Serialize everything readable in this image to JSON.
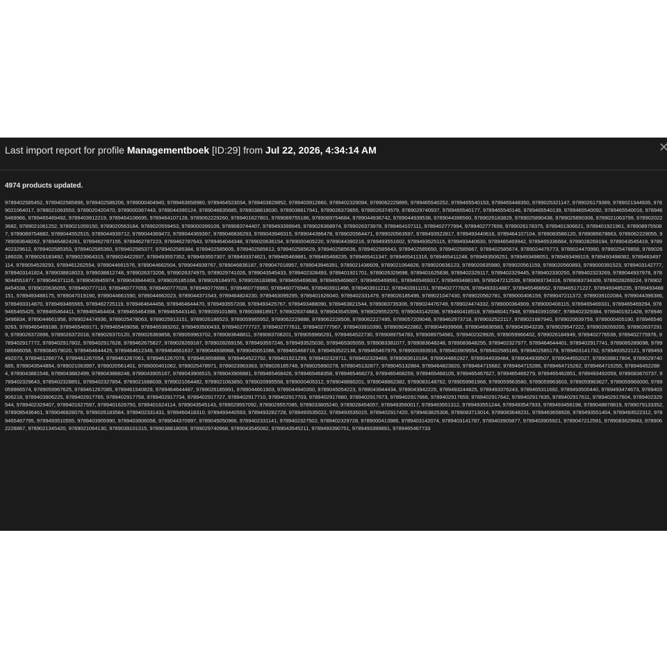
{
  "report": {
    "title_prefix": "Last import report for profile ",
    "profile_name": "Managementboek",
    "profile_id": " [ID:29] from ",
    "timestamp": "Jul 22, 2026, 4:34:14 AM",
    "close_glyph": "✕",
    "summary": "4974 products updated.",
    "codes": "9789402585452, 9789402585896, 9789402586206, 9789000404940, 9789463658980, 9789464523034, 9789403829852, 9789403912660, 9789402329094, 9789062229895, 9789465540252, 9789465540153, 9789465448350, 9789025321147, 9789026179389, 9789021344935, 9789021064017, 9789021063553, 9789020420470, 9789000367443, 9789044390124, 9789046835685, 9789038818030, 9789038817941, 9789026373855, 9789026374579, 9789029740937, 9789465540177, 9789465540146, 9789465540139, 9789465540092, 9789465540016, 9789465469966, 9789465469492, 9789403912219, 9789464106695, 9789464107128, 9789062229260, 9789401627801, 9789089755186, 9789089754684, 9789044936742, 9789044939538, 9789044396560, 9789026183829, 9789025890438, 9789025890308, 9789021063799, 9789020223682, 9789021061252, 9789021059150, 9789020563184, 9789020559453, 9789000399109, 9789083744407, 9789493399945, 9789026368974, 9789026373978, 9789464107111, 9789402777994, 9789402777659, 9789026178375, 9789401306621, 9789401921961, 9789089755087, 9789089754882, 9789044552515, 9789044939712, 9789044369472, 9789044369397, 9789046836293, 9789043946315, 9789044396478, 9789020564471, 9789020563597, 9789493522817, 9789493440616, 9789464107104, 9789083586120, 9789085678663, 9789062229055, 9789083648262, 9789464824261, 9789462787155, 9789462787223, 9789462787643, 9789464044348, 9789020636154, 9789000405220, 9789044390216, 9789493551602, 9789493525115, 9789493440630, 9789465469942, 9789465336664, 9789028269194, 9789043545419, 9789402329612, 9789402585353, 9789402585360, 9789402585377, 9789402585384, 9789402585605, 9789402585612, 9789402585629, 9789402585636, 9789402585643, 9789402585650, 9789402585667, 9789402585674, 9789024475773, 9789024470990, 9789025478858, 9789026186028, 9789026183492, 9789023964315, 9789024422937, 9789493557352, 9789493557307, 9789493374621, 9789465469881, 9789465468235, 9789465411347, 9789465411316, 9789465411248, 9789493506251, 9789493498051, 9789493499119, 9789493498082, 9789463497114, 9789054529293, 9789461262554, 9789044661576, 9789044662504, 9789044939767, 9789046836187, 9789047018957, 9789043946391, 9789021436609, 9789021064826, 9789020636123, 9789020635980, 9789020561159, 9789020560893, 9789000391523, 9789403142777, 9789403141824, 9789038818023, 9789038812748, 9789026373206, 9789026374975, 9789029741026, 9789043545433, 9789402328493, 9789401921701, 9789026329698, 9789401625838, 9789402329117, 9789402329445, 9789402330250, 9789402323269, 9789044937978, 9789044551877, 9789044371116, 9789043945974, 9789043944403, 9789026185168, 9789026184970, 9789026183898, 9789465469638, 9789465469607, 9789465469591, 9789465469317, 9789493488199, 9789047212539, 9789083734316, 9789083734309, 9789028269224, 9789028454538, 9789020636055, 9789460777110, 9789460777059, 9789460777028, 9789460776991, 9789460776960, 9789460776946, 9789403911496, 9789403911212, 9789403911151, 9789402777826, 9789493314887, 9789465468662, 9789465171227, 9789493485235, 9789493488151, 9789493488175, 9789047019190, 9789044661590, 9789044662023, 9789044371543, 9789464824230, 9789463099295, 9789401626040, 9789402331479, 9789026185496, 9789021047430, 9789020562781, 9789000406159, 9789047211372, 9789039102084, 9789044396386, 9789493314870, 9789493465565, 9789462725119, 9789464644456, 9789464644470, 9789493557208, 9789493425767, 9789493488090, 9789463821544, 9789083735306, 9789024476749, 9789024474332, 9789000364909, 9789000408115, 9789465469331, 9789465469294, 9789465465425, 9789465464411, 9789465464404, 9789465464398, 9789465443140, 9789039101889, 9789038818917, 9789026374883, 9789043545396, 9789029552370, 9789043142036, 9789460418518, 9789460417948, 9789403910567, 9789402329384, 9789401921428, 9789463496834, 9789044661958, 9789024474936, 9789025478063, 9789025913151, 9789026186523, 9789059965952, 9789062229888, 9789062228508, 9789062227495, 9789057209048, 9789462973718, 9789032522117, 9789021687940, 9789020639759, 9789000405190, 9789465469263, 9789465469188, 9789465469171, 9789465469058, 9789465383262, 9789493500433, 9789402777727, 9789402777611, 9789402777567, 9789403910390, 9789090422862, 9789044939668, 9789046836583, 9789043943239, 9789029547222, 9789028269200, 9789026372919, 9789026372896, 9789026372018, 9789026370120, 9789026369858, 9789059963702, 9789083648811, 9789083708201, 9789059966291, 9789464522730, 9789089754783, 9789089754981, 9789402329926, 9789059966402, 9789026184949, 9789402776539, 9789402775976, 9789402917772, 9789402917802, 9789402917628, 9789462675827, 9789028269187, 9789028269156, 9789493557246, 9789493525030, 9789465305059, 9789083381077, 9789083648248, 9789083648255, 9789402327977, 9789464644401, 9789402917741, 9789085289098, 9789086666058, 9789084579020, 9789464644425, 9789464612349, 9789464661637, 9789044938968, 9789045051086, 9789465468716, 9789493522138, 9789465467979, 9789000393916, 9789403909554, 9789402585186, 9789402585179, 9789403141732, 9789493522121, 9789493492073, 9789461266774, 9789461267054, 9789461267061, 9789461267078, 9789463658898, 9789464522792, 9789401921299, 9789402329711, 9789402329469, 9789083610184, 9789044661927, 9789044939484, 9789044939507, 9789044552027, 9789038817804, 9789029740685, 9789043544894, 9789021063997, 9789020561401, 9789000401062, 9789025478971, 9789023963363, 9789026185748, 9789025890278, 9789045132877, 9789045132884, 9789464823820, 9789464715682, 9789464715286, 9789464715262, 9789464715255, 9789464522884, 9789043881546, 9789043882499, 9789043888248, 9789043905167, 9789043906515, 9789043906881, 9789465468426, 9789465468358, 9789465468273, 9789465468259, 9789465468105, 9789465467627, 9789465466279, 9789465462851, 9789493492059, 9789083670737, 9789402329643, 9789402328851, 9789402327854, 9789021688039, 9789021064482, 9789021063850, 9789020995558, 9789000405312, 9789048880201, 9789048862382, 9789083148762, 9789059961968, 9789059963580, 9789059963603, 9789059963627, 9789059966000, 9789059966574, 9789059967625, 9789461267085, 9789461540829, 9789464644487, 9789026185991, 9789044661903, 9789044940350, 9789045054223, 9789043944434, 9789043942225, 9789493244825, 9789493376243, 9789465311692, 9789493500440, 9789493474673, 9789403906218, 9789403906225, 9789402917765, 9789402917758, 9789402917734, 9789402917727, 9789402917710, 9789402917703, 9789402917680, 9789402917673, 9789402917666, 9789402917659, 9789402917642, 9789402917635, 9789402917611, 9789402917604, 9789402329544, 9789402329407, 9789401627597, 9789401626750, 9789401624114, 9789043545143, 9789029557092, 9789029557085, 9789033805240, 9789028454057, 9789493560017, 9789493551312, 9789493551244, 9789493547933, 9789493456198, 9789048878819, 9789079133352, 9789085436461, 9789046828076, 9789026183584, 9789402331431, 9789460418310, 9789493440593, 9789493282728, 9789493535022, 9789493535015, 9789402917420, 9789463825306, 9789083713014, 9789083648231, 9789463658928, 9789493551404, 9789493522312, 9789465467795, 9789493510555, 9789403905990, 9789403906058, 9789044370997, 9789045050966, 9789402331141, 9789402327502, 9789402329728, 9789000413986, 9789403142074, 9789403141787, 9789403905877, 9789403905921, 9789047212591, 9789083629643, 9789062228867, 9789021345420, 9789021064130, 9789039101315, 9789038818009, 9789029740968, 9789043545082, 9789043545211, 9789493390751, 9789493399891, 9789465467733"
  },
  "colors": {
    "background": "#1b1b1b",
    "text": "#dcdcdc",
    "divider": "#3a3a3a"
  }
}
